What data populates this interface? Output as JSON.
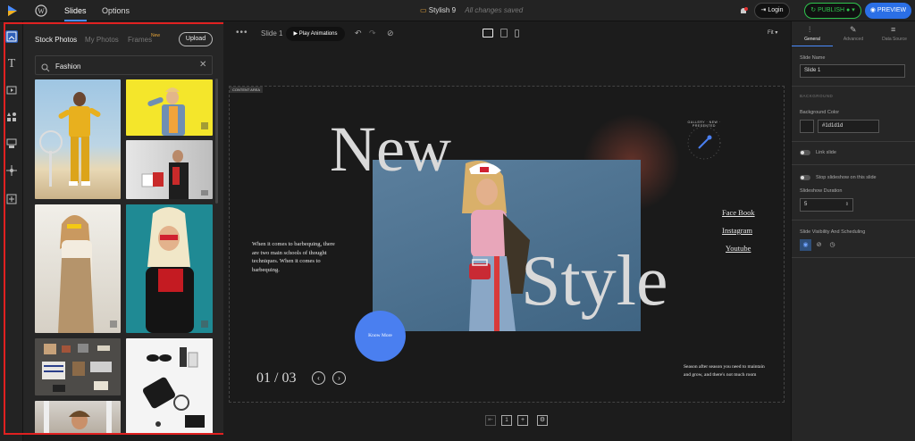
{
  "topbar": {
    "tabs": [
      {
        "label": "Slides"
      },
      {
        "label": "Options"
      }
    ],
    "slider_name": "Stylish 9",
    "save_status": "All changes saved",
    "login_label": "Login",
    "publish_label": "PUBLISH",
    "preview_label": "PREVIEW"
  },
  "panel": {
    "tabs": [
      {
        "label": "Stock Photos"
      },
      {
        "label": "My Photos"
      },
      {
        "label": "Frames"
      }
    ],
    "new_badge": "New",
    "upload_label": "Upload",
    "search_value": "Fashion"
  },
  "canvas": {
    "slide_label": "Slide 1",
    "play_label": "Play Animations",
    "fit_label": "Fit",
    "content_area_label": "CONTENT AREA",
    "headline_1": "New",
    "headline_2": "Style",
    "intro_text": "When it comes to barbequing, there are two main schools of thought techniques. When it comes to barbequing.",
    "cta_label": "Know More",
    "social_links": [
      "Face Book",
      "Instagram",
      "Youtube"
    ],
    "counter": "01 / 03",
    "bottom_text": "Season after season you need to maintain and grow, and there's not much room",
    "gallery_badge": "GALLERY · NEW · PRESENTED"
  },
  "right_panel": {
    "tabs": [
      {
        "label": "General"
      },
      {
        "label": "Advanced"
      },
      {
        "label": "Data Source"
      }
    ],
    "slide_name_label": "Slide Name",
    "slide_name_value": "Slide 1",
    "background_section": "BACKGROUND",
    "bg_color_label": "Background Color",
    "bg_color_value": "#1d1d1d",
    "link_slide_label": "Link slide",
    "stop_slideshow_label": "Stop slideshow on this slide",
    "duration_label": "Slideshow Duration",
    "duration_value": "5",
    "visibility_label": "Slide Visibility And Scheduling"
  },
  "colors": {
    "accent": "#4a8cff",
    "publish_green": "#2ec44d",
    "highlight_red": "#e02020",
    "cta_blue": "#4a7ff0"
  }
}
